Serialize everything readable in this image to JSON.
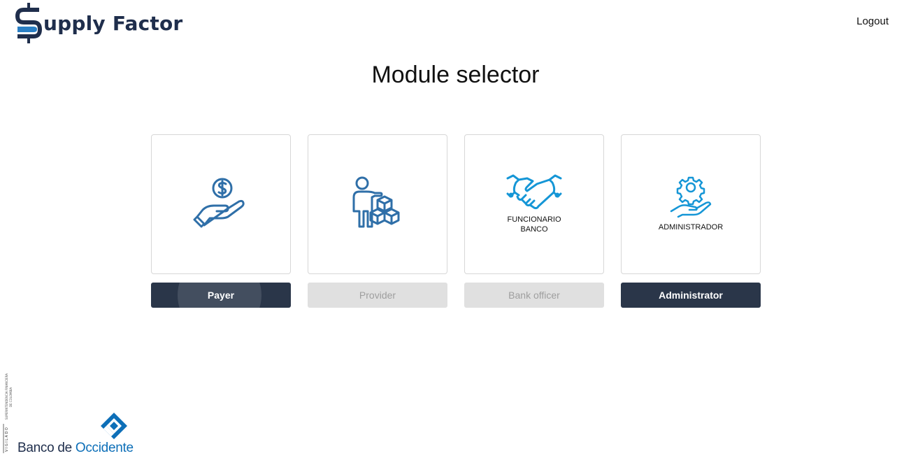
{
  "header": {
    "logo_text": "upply Factor",
    "logout_label": "Logout"
  },
  "page": {
    "title": "Module selector"
  },
  "modules": [
    {
      "id": "payer",
      "icon": "hand-dollar-icon",
      "caption": "",
      "button_label": "Payer",
      "enabled": true
    },
    {
      "id": "provider",
      "icon": "person-boxes-icon",
      "caption": "",
      "button_label": "Provider",
      "enabled": false
    },
    {
      "id": "bank-officer",
      "icon": "handshake-icon",
      "caption_line1": "FUNCIONARIO",
      "caption_line2": "BANCO",
      "button_label": "Bank officer",
      "enabled": false
    },
    {
      "id": "administrator",
      "icon": "hand-gear-icon",
      "caption": "ADMINISTRADOR",
      "button_label": "Administrator",
      "enabled": true
    }
  ],
  "footer": {
    "bank_name_part1": "Banco de ",
    "bank_name_part2": "Occidente",
    "vigilado_text": "VIGILADO",
    "supervisor_text": "SUPERINTENDENCIA FINANCIERA DE COLOMBIA"
  },
  "colors": {
    "brand_dark": "#1f2e4c",
    "brand_blue": "#0d6fb8",
    "icon_blue": "#2f6fa8",
    "icon_cyan": "#1596d6",
    "button_active": "#2a3649",
    "button_disabled": "#e0e0e0"
  }
}
